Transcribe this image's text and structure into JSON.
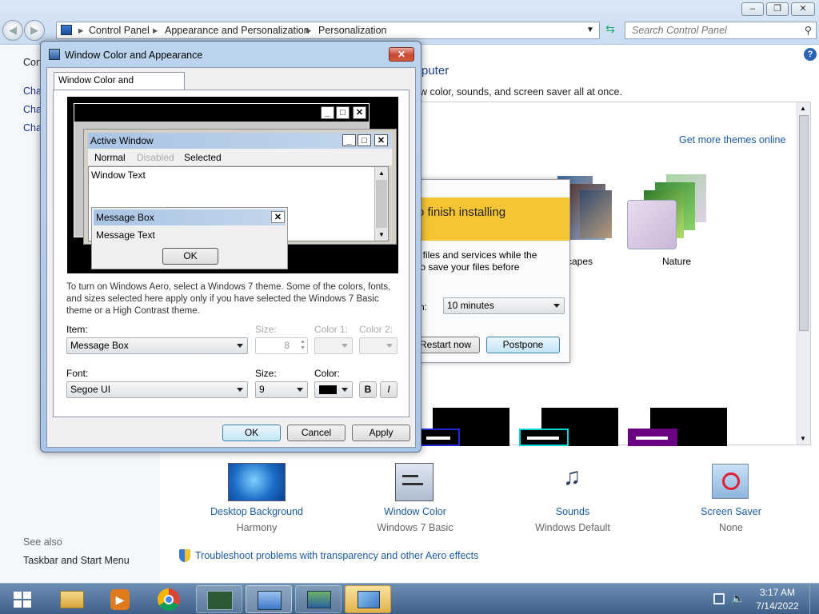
{
  "explorer": {
    "breadcrumb": [
      "Control Panel",
      "Appearance and Personalization",
      "Personalization"
    ],
    "search_placeholder": "Search Control Panel",
    "caption_buttons": {
      "minimize": "–",
      "maximize": "❐",
      "close": "✕"
    }
  },
  "left_pane": {
    "items": [
      "Con",
      "Cha",
      "Cha",
      "Cha"
    ],
    "see_also": "See also",
    "taskbar_link": "Taskbar and Start Menu"
  },
  "main": {
    "heading_fragment": "puter",
    "subtitle_fragment": "w color, sounds, and screen saver all at once.",
    "get_more_themes": "Get more themes online",
    "themes": [
      {
        "label": "capes"
      },
      {
        "label": "Nature"
      }
    ],
    "bottom_items": [
      {
        "link": "Desktop Background",
        "sub": "Harmony"
      },
      {
        "link": "Window Color",
        "sub": "Windows 7 Basic"
      },
      {
        "link": "Sounds",
        "sub": "Windows Default"
      },
      {
        "link": "Screen Saver",
        "sub": "None"
      }
    ],
    "troubleshoot": "Troubleshoot problems with transparency and other Aero effects"
  },
  "update_dialog": {
    "banner": "o finish installing",
    "line1": "t files and services while the",
    "line2": " to save your files before",
    "label_fragment": "n:",
    "delay_value": "10 minutes",
    "restart_label": "Restart now",
    "postpone_label": "Postpone"
  },
  "dialog": {
    "title": "Window Color and Appearance",
    "tab": "Window Color and Appearance",
    "preview": {
      "active_window": "Active Window",
      "menu": [
        "Normal",
        "Disabled",
        "Selected"
      ],
      "window_text": "Window Text",
      "message_box": "Message Box",
      "message_text": "Message Text",
      "ok": "OK"
    },
    "info": "To turn on Windows Aero, select a Windows 7 theme.  Some of the colors, fonts, and sizes selected here apply only if you have selected the Windows 7 Basic theme or a High Contrast theme.",
    "item_label": "Item:",
    "item_value": "Message Box",
    "size_label": "Size:",
    "size_value": "8",
    "color1_label": "Color 1:",
    "color2_label": "Color 2:",
    "font_label": "Font:",
    "font_value": "Segoe UI",
    "font_size_label": "Size:",
    "font_size_value": "9",
    "color_label": "Color:",
    "font_color": "#000000",
    "bold_label": "B",
    "italic_label": "I",
    "ok_label": "OK",
    "cancel_label": "Cancel",
    "apply_label": "Apply"
  },
  "taskbar": {
    "time": "3:17 AM",
    "date": "7/14/2022",
    "icons": [
      "windows-start-icon",
      "file-explorer-icon",
      "media-player-icon",
      "chrome-icon",
      "task-manager-icon",
      "control-panel-icon",
      "remote-desktop-icon",
      "personalization-icon"
    ]
  },
  "colors": {
    "link": "#1b5ba5",
    "dialog_frame": "#a8c4e6",
    "taskbar": "#3e5f88",
    "banner": "#f7c534"
  }
}
